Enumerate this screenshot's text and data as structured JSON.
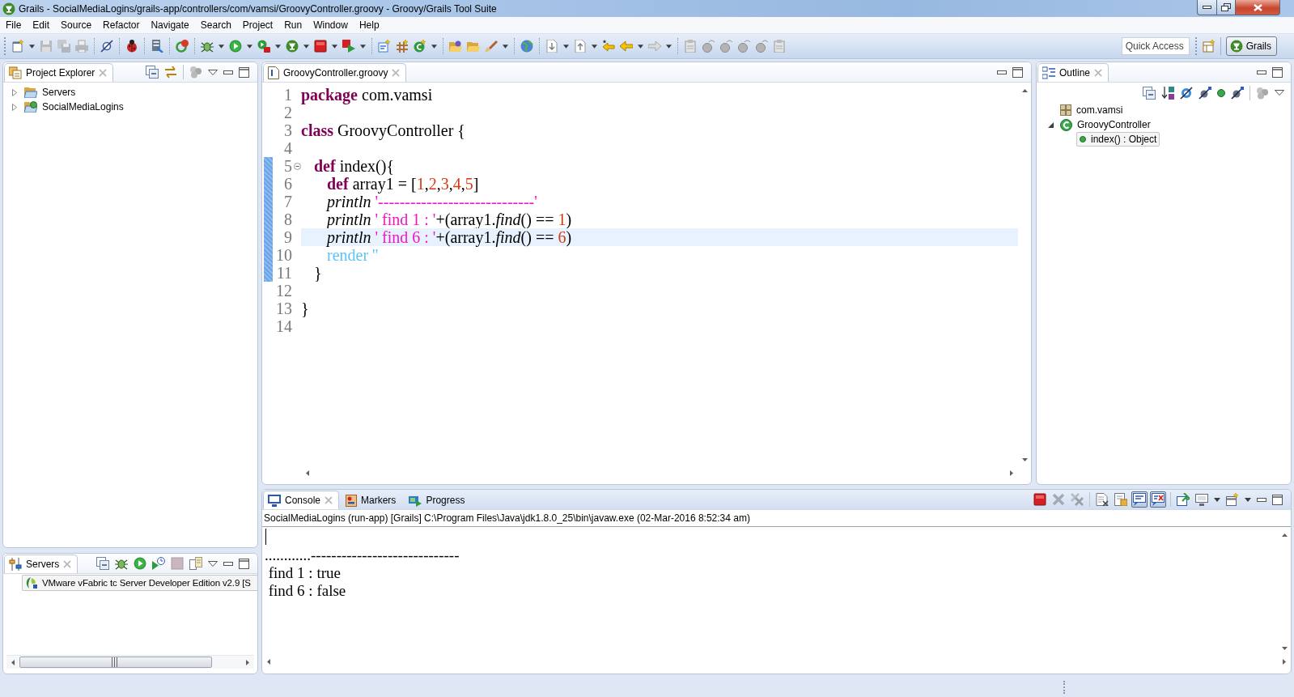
{
  "window": {
    "title": "Grails - SocialMediaLogins/grails-app/controllers/com/vamsi/GroovyController.groovy - Groovy/Grails Tool Suite"
  },
  "menu": [
    "File",
    "Edit",
    "Source",
    "Refactor",
    "Navigate",
    "Search",
    "Project",
    "Run",
    "Window",
    "Help"
  ],
  "toolbar": {
    "quick_access": {
      "placeholder": "Quick Access"
    },
    "perspectives": [
      {
        "label": "Grails",
        "selected": true
      }
    ]
  },
  "project_explorer": {
    "title": "Project Explorer",
    "items": [
      {
        "label": "Servers",
        "kind": "folder",
        "expanded": false
      },
      {
        "label": "SocialMediaLogins",
        "kind": "project",
        "expanded": false
      }
    ]
  },
  "servers_view": {
    "title": "Servers",
    "items": [
      {
        "label": "VMware vFabric tc Server Developer Edition v2.9 [S",
        "selected": true
      }
    ]
  },
  "editor": {
    "tab": {
      "label": "GroovyController.groovy"
    },
    "lines": [
      {
        "number": "1",
        "selected": false,
        "in_range": false,
        "foldable": false,
        "tokens": [
          {
            "kind": "keyword",
            "text": "package"
          },
          {
            "kind": "plain",
            "text": " com.vamsi"
          }
        ]
      },
      {
        "number": "2",
        "selected": false,
        "in_range": false,
        "foldable": false
      },
      {
        "number": "3",
        "selected": false,
        "in_range": false,
        "foldable": false,
        "tokens": [
          {
            "kind": "keyword",
            "text": "class"
          },
          {
            "kind": "plain",
            "text": " GroovyController {"
          }
        ]
      },
      {
        "number": "4",
        "selected": false,
        "in_range": false,
        "foldable": false
      },
      {
        "number": "5",
        "selected": false,
        "in_range": true,
        "foldable": true,
        "tokens": [
          {
            "kind": "keyword",
            "text": "\tdef"
          },
          {
            "kind": "plain",
            "text": " index(){"
          }
        ]
      },
      {
        "number": "6",
        "selected": false,
        "in_range": true,
        "foldable": false,
        "tokens": [
          {
            "kind": "keyword",
            "text": "\t\tdef"
          },
          {
            "kind": "plain",
            "text": " array1 = ["
          },
          {
            "kind": "number",
            "text": "1"
          },
          {
            "kind": "plain",
            "text": ","
          },
          {
            "kind": "number",
            "text": "2"
          },
          {
            "kind": "plain",
            "text": ","
          },
          {
            "kind": "number",
            "text": "3"
          },
          {
            "kind": "plain",
            "text": ","
          },
          {
            "kind": "number",
            "text": "4"
          },
          {
            "kind": "plain",
            "text": ","
          },
          {
            "kind": "number",
            "text": "5"
          },
          {
            "kind": "plain",
            "text": "]"
          }
        ]
      },
      {
        "number": "7",
        "selected": false,
        "in_range": true,
        "foldable": false,
        "tokens": [
          {
            "kind": "method",
            "text": "\t\tprintln"
          },
          {
            "kind": "string",
            "text": " '-----------------------------'"
          }
        ]
      },
      {
        "number": "8",
        "selected": false,
        "in_range": true,
        "foldable": false,
        "tokens": [
          {
            "kind": "method",
            "text": "\t\tprintln"
          },
          {
            "kind": "string",
            "text": " ' find 1 : '"
          },
          {
            "kind": "plain",
            "text": "+(array1."
          },
          {
            "kind": "method",
            "text": "find"
          },
          {
            "kind": "plain",
            "text": "() == "
          },
          {
            "kind": "number",
            "text": "1"
          },
          {
            "kind": "plain",
            "text": ")"
          }
        ]
      },
      {
        "number": "9",
        "selected": true,
        "in_range": true,
        "foldable": false,
        "tokens": [
          {
            "kind": "method",
            "text": "\t\tprintln"
          },
          {
            "kind": "string",
            "text": " ' find 6 : '"
          },
          {
            "kind": "plain",
            "text": "+(array1."
          },
          {
            "kind": "method",
            "text": "find"
          },
          {
            "kind": "plain",
            "text": "() == "
          },
          {
            "kind": "number",
            "text": "6"
          },
          {
            "kind": "plain",
            "text": ")"
          }
        ]
      },
      {
        "number": "10",
        "selected": false,
        "in_range": true,
        "foldable": false,
        "tokens": [
          {
            "kind": "dynamic",
            "text": "\t\trender ''"
          }
        ]
      },
      {
        "number": "11",
        "selected": false,
        "in_range": true,
        "foldable": false,
        "tokens": [
          {
            "kind": "plain",
            "text": "\t}"
          }
        ]
      },
      {
        "number": "12",
        "selected": false,
        "in_range": false,
        "foldable": false
      },
      {
        "number": "13",
        "selected": false,
        "in_range": false,
        "foldable": false,
        "tokens": [
          {
            "kind": "plain",
            "text": "}"
          }
        ]
      },
      {
        "number": "14",
        "selected": false,
        "in_range": false,
        "foldable": false
      }
    ]
  },
  "outline": {
    "title": "Outline",
    "items": [
      {
        "label": "com.vamsi",
        "kind": "package",
        "selected": false
      },
      {
        "label": "GroovyController",
        "kind": "class",
        "selected": false,
        "expanded": true,
        "children": [
          {
            "label": "index() : Object",
            "kind": "method",
            "selected": true
          }
        ]
      }
    ]
  },
  "console": {
    "tabs": [
      {
        "label": "Console",
        "kind": "console",
        "selected": true
      },
      {
        "label": "Markers",
        "kind": "markers",
        "selected": false
      },
      {
        "label": "Progress",
        "kind": "progress",
        "selected": false
      }
    ],
    "toggles": [
      {
        "on": true
      },
      {
        "on": true
      }
    ],
    "process": "SocialMediaLogins (run-app) [Grails] C:\\Program Files\\Java\\jdk1.8.0_25\\bin\\javaw.exe (02-Mar-2016 8:52:34 am)",
    "output": [
      "............-----------------------------",
      " find 1 : true",
      " find 6 : false"
    ]
  }
}
